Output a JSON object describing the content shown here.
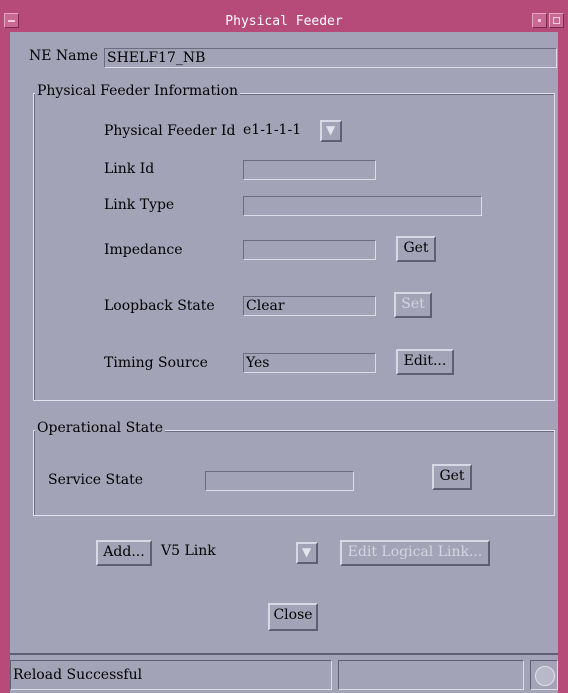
{
  "window": {
    "title": "Physical Feeder"
  },
  "ne": {
    "label": "NE Name",
    "value": "SHELF17_NB"
  },
  "pfi": {
    "legend": "Physical Feeder Information",
    "feeder_id": {
      "label": "Physical Feeder Id",
      "value": "e1-1-1-1"
    },
    "link_id": {
      "label": "Link Id",
      "value": ""
    },
    "link_type": {
      "label": "Link Type",
      "value": ""
    },
    "impedance": {
      "label": "Impedance",
      "value": "",
      "button": "Get"
    },
    "loopback": {
      "label": "Loopback State",
      "value": "Clear",
      "button": "Set"
    },
    "timing": {
      "label": "Timing Source",
      "value": "Yes",
      "button": "Edit..."
    }
  },
  "ops": {
    "legend": "Operational State",
    "service": {
      "label": "Service State",
      "value": "",
      "button": "Get"
    }
  },
  "bottom": {
    "add_label": "Add...",
    "link_select": "V5 Link",
    "edit_logical": "Edit Logical Link...",
    "close_label": "Close"
  },
  "status": {
    "message": "Reload Successful",
    "secondary": ""
  }
}
